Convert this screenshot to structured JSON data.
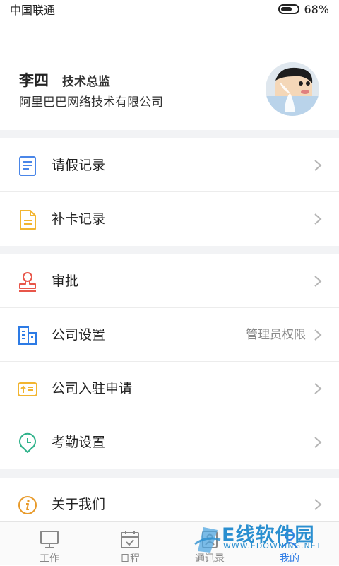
{
  "status_bar": {
    "carrier": "中国联通",
    "battery_text": "68%",
    "battery_level": 0.68
  },
  "profile": {
    "name": "李四",
    "title": "技术总监",
    "company": "阿里巴巴网络技术有限公司",
    "avatar_icon": "cartoon-avatar"
  },
  "menu": {
    "leave_records": {
      "label": "请假记录",
      "icon": "document-icon",
      "color": "#4a86e8"
    },
    "clock_records": {
      "label": "补卡记录",
      "icon": "file-icon",
      "color": "#f2b530"
    },
    "approval": {
      "label": "审批",
      "icon": "stamp-icon",
      "color": "#e8564a"
    },
    "company_settings": {
      "label": "公司设置",
      "sub": "管理员权限",
      "icon": "building-icon",
      "color": "#2d7be5"
    },
    "company_join": {
      "label": "公司入驻申请",
      "icon": "upload-card-icon",
      "color": "#f2b530"
    },
    "attendance_settings": {
      "label": "考勤设置",
      "icon": "clock-pin-icon",
      "color": "#2fb28a"
    },
    "about_us": {
      "label": "关于我们",
      "icon": "info-icon",
      "color": "#e89a2a"
    }
  },
  "tab_bar": {
    "tabs": [
      {
        "label": "工作",
        "icon": "monitor-icon"
      },
      {
        "label": "日程",
        "icon": "calendar-icon"
      },
      {
        "label": "通讯录",
        "icon": "contacts-icon"
      },
      {
        "label": "我的",
        "icon": "user-icon"
      }
    ],
    "active_index": 3,
    "active_color": "#2d7be5"
  },
  "watermark": {
    "main": "E线软件园",
    "sub": "WWW.EDOWNING.NET"
  }
}
